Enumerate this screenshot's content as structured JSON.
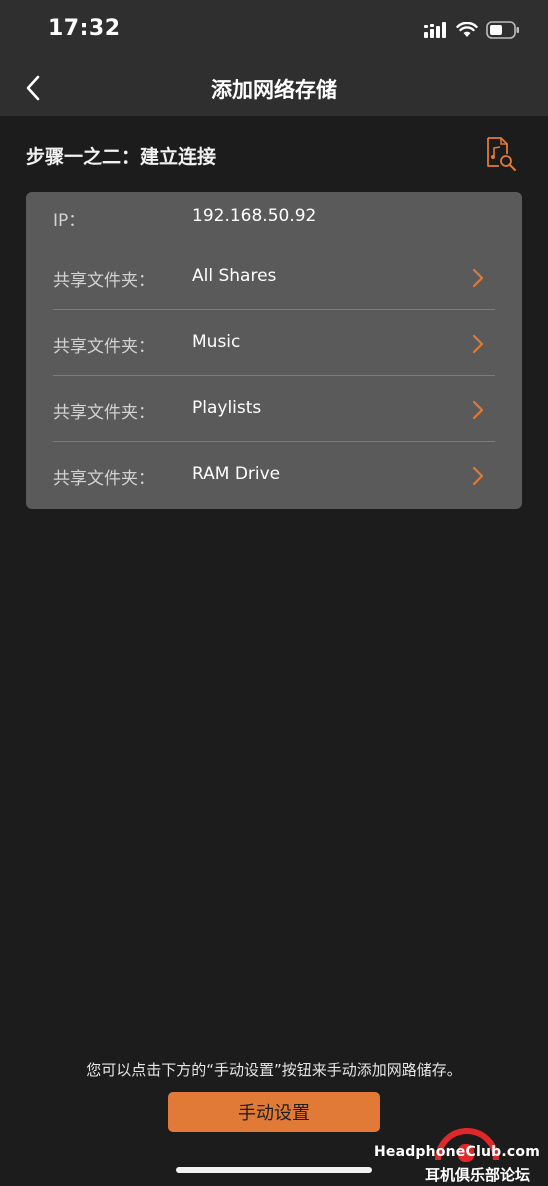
{
  "status_bar": {
    "time": "17:32",
    "icons": [
      "cellular-signal-icon",
      "wifi-icon",
      "battery-icon"
    ]
  },
  "nav": {
    "title": "添加网络存储",
    "back_icon": "chevron-left-icon"
  },
  "step": {
    "title": "步骤一之二：建立连接",
    "action_icon": "file-search-icon"
  },
  "connection": {
    "ip_label": "IP：",
    "ip_value": "192.168.50.92",
    "shares": [
      {
        "label": "共享文件夹：",
        "value": "All Shares"
      },
      {
        "label": "共享文件夹：",
        "value": "Music"
      },
      {
        "label": "共享文件夹：",
        "value": "Playlists"
      },
      {
        "label": "共享文件夹：",
        "value": "RAM Drive"
      }
    ]
  },
  "footer": {
    "hint": "您可以点击下方的“手动设置”按钮来手动添加网路储存。",
    "manual_button": "手动设置"
  },
  "watermark": {
    "line1": "HeadphoneClub.com",
    "line2": "耳机俱乐部论坛"
  },
  "colors": {
    "accent": "#e07a36",
    "background": "#1c1c1c",
    "bar": "#2f2f2f",
    "card": "#5a5a5a"
  }
}
